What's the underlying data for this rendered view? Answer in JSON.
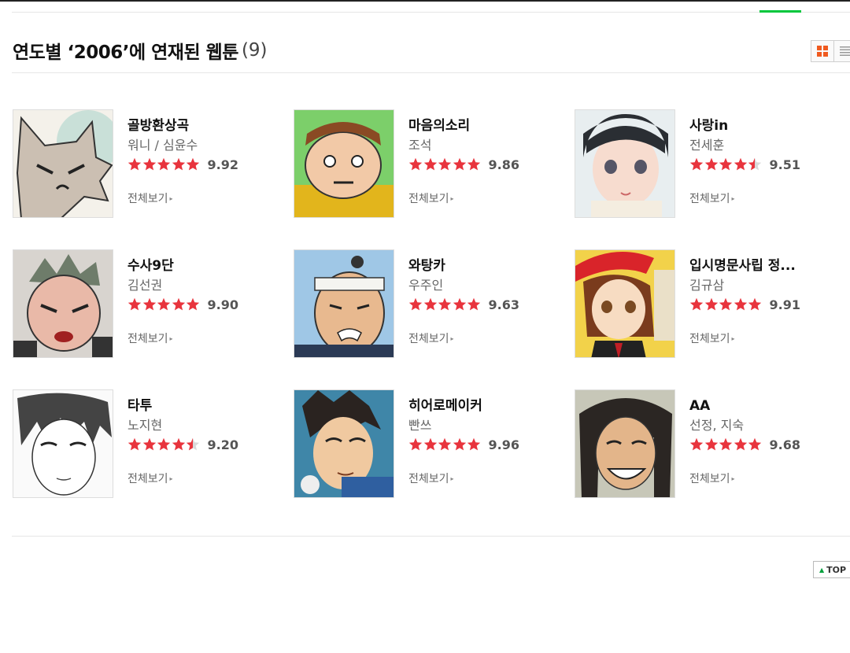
{
  "header": {
    "title": "연도별 ‘2006’에 연재된 웹툰",
    "count": "(9)"
  },
  "view_toggle": {
    "grid_icon": "grid-view-icon",
    "list_icon": "list-view-icon",
    "active": "grid",
    "active_color": "#f05a1f"
  },
  "colors": {
    "star": "#e8343d",
    "accent": "#00c73c"
  },
  "items": [
    {
      "title": "골방환상곡",
      "author": "워니 / 심윤수",
      "score": "9.92",
      "stars": 5,
      "see_all": "전체보기"
    },
    {
      "title": "마음의소리",
      "author": "조석",
      "score": "9.86",
      "stars": 5,
      "see_all": "전체보기"
    },
    {
      "title": "사랑in",
      "author": "전세훈",
      "score": "9.51",
      "stars": 4.5,
      "see_all": "전체보기"
    },
    {
      "title": "수사9단",
      "author": "김선권",
      "score": "9.90",
      "stars": 5,
      "see_all": "전체보기"
    },
    {
      "title": "와탕카",
      "author": "우주인",
      "score": "9.63",
      "stars": 5,
      "see_all": "전체보기"
    },
    {
      "title": "입시명문사립 정...",
      "author": "김규삼",
      "score": "9.91",
      "stars": 5,
      "see_all": "전체보기"
    },
    {
      "title": "타투",
      "author": "노지현",
      "score": "9.20",
      "stars": 4.5,
      "see_all": "전체보기"
    },
    {
      "title": "히어로메이커",
      "author": "빤쓰",
      "score": "9.96",
      "stars": 5,
      "see_all": "전체보기"
    },
    {
      "title": "AA",
      "author": "선정, 지숙",
      "score": "9.68",
      "stars": 5,
      "see_all": "전체보기"
    }
  ],
  "top_button": {
    "label": "TOP",
    "icon": "up-triangle-icon"
  }
}
